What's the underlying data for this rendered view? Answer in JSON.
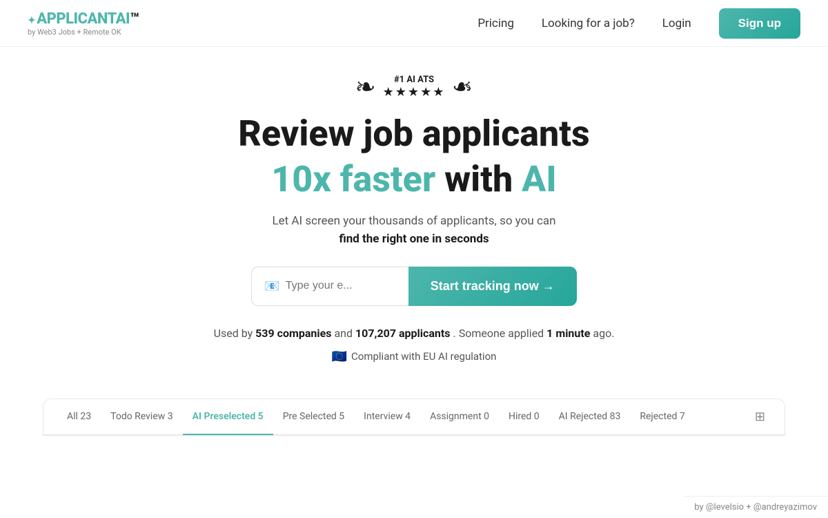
{
  "navbar": {
    "logo_main": "APPLICANT",
    "logo_accent": "AI",
    "logo_star": "✦",
    "logo_sub": "by Web3 Jobs + Remote OK",
    "links": [
      {
        "label": "Pricing",
        "id": "pricing"
      },
      {
        "label": "Looking for a job?",
        "id": "jobs"
      },
      {
        "label": "Login",
        "id": "login"
      }
    ],
    "signup_label": "Sign up"
  },
  "hero": {
    "badge_rank": "#1 AI ATS",
    "badge_stars": "★★★★★",
    "title_line1": "Review job applicants",
    "title_line2_normal": "faster with",
    "title_line2_teal": "10x faster with",
    "title_line2_accent": "AI",
    "sub_text": "Let AI screen your thousands of applicants, so you can",
    "sub_bold": "find the right one in seconds",
    "email_placeholder": "Type your e...",
    "email_emoji": "📧",
    "cta_label": "Start tracking now →",
    "stats": {
      "prefix": "Used by",
      "companies_count": "539 companies",
      "and": "and",
      "applicants_count": "107,207 applicants",
      "someone_applied": ". Someone applied",
      "time_ago": "1 minute",
      "suffix": "ago."
    },
    "eu_text": "Compliant with EU AI regulation",
    "eu_flag": "🇪🇺"
  },
  "tabs": [
    {
      "label": "All 23",
      "active": false
    },
    {
      "label": "Todo Review 3",
      "active": false
    },
    {
      "label": "AI Preselected 5",
      "active": true
    },
    {
      "label": "Pre Selected 5",
      "active": false
    },
    {
      "label": "Interview 4",
      "active": false
    },
    {
      "label": "Assignment 0",
      "active": false
    },
    {
      "label": "Hired 0",
      "active": false
    },
    {
      "label": "AI Rejected 83",
      "active": false
    },
    {
      "label": "Rejected 7",
      "active": false
    }
  ],
  "footer": {
    "credit": "by @levelsio + @andreyazimov"
  }
}
